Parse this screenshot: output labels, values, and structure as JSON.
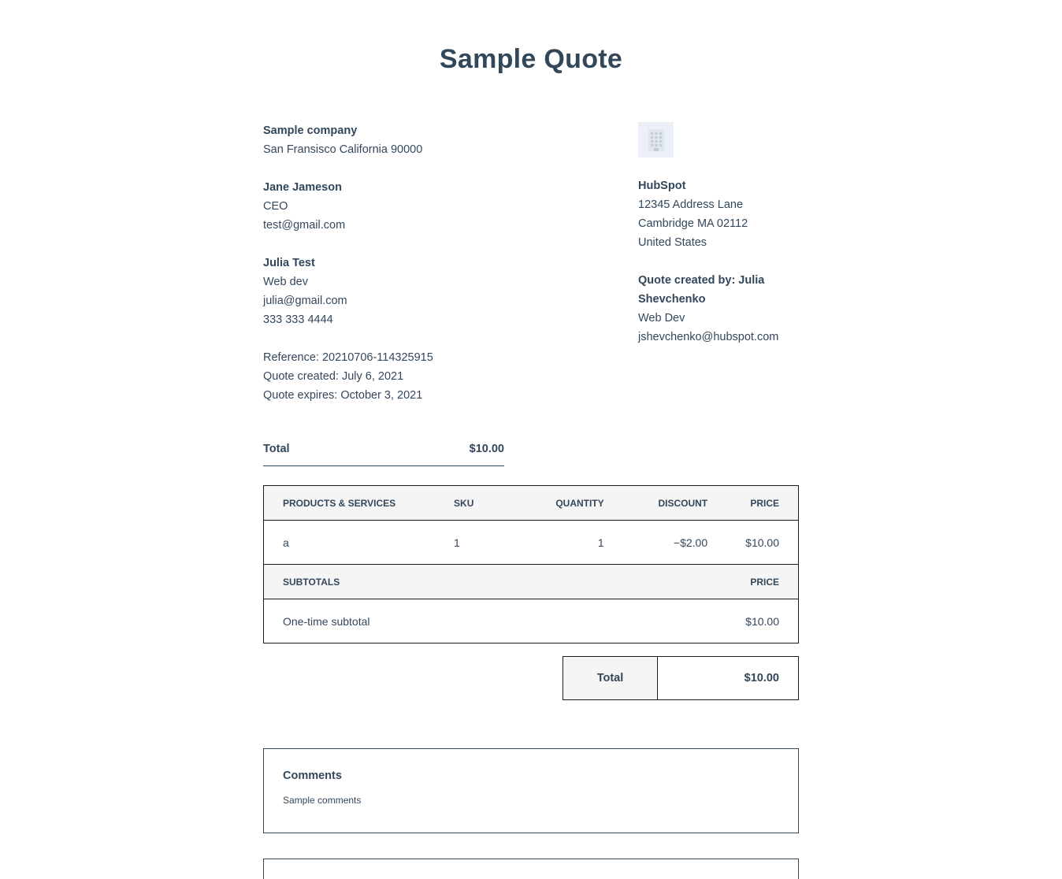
{
  "title": "Sample Quote",
  "buyer_company": {
    "name": "Sample company",
    "address": "San Fransisco California 90000"
  },
  "contact1": {
    "name": "Jane Jameson",
    "role": "CEO",
    "email": "test@gmail.com"
  },
  "contact2": {
    "name": "Julia Test",
    "role": "Web dev",
    "email": "julia@gmail.com",
    "phone": "333 333 4444"
  },
  "meta": {
    "reference": "Reference: 20210706-114325915",
    "created": "Quote created: July 6, 2021",
    "expires": "Quote expires: October 3, 2021"
  },
  "seller": {
    "logo_icon": "building-icon",
    "name": "HubSpot",
    "address1": "12345 Address Lane",
    "address2": "Cambridge MA 02112",
    "country": "United States"
  },
  "creator": {
    "heading": "Quote created by: Julia Shevchenko",
    "role": "Web Dev",
    "email": "jshevchenko@hubspot.com"
  },
  "summary": {
    "label": "Total",
    "value": "$10.00"
  },
  "items_table": {
    "headers": {
      "product": "PRODUCTS & SERVICES",
      "sku": "SKU",
      "quantity": "QUANTITY",
      "discount": "DISCOUNT",
      "price": "PRICE"
    },
    "rows": [
      {
        "product": "a",
        "sku": "1",
        "quantity": "1",
        "discount": "−$2.00",
        "price": "$10.00"
      }
    ],
    "subtotal_headers": {
      "label": "SUBTOTALS",
      "price": "PRICE"
    },
    "subtotal_rows": [
      {
        "label": "One-time subtotal",
        "price": "$10.00"
      }
    ]
  },
  "total": {
    "label": "Total",
    "value": "$10.00"
  },
  "comments": {
    "heading": "Comments",
    "body": "Sample comments"
  }
}
